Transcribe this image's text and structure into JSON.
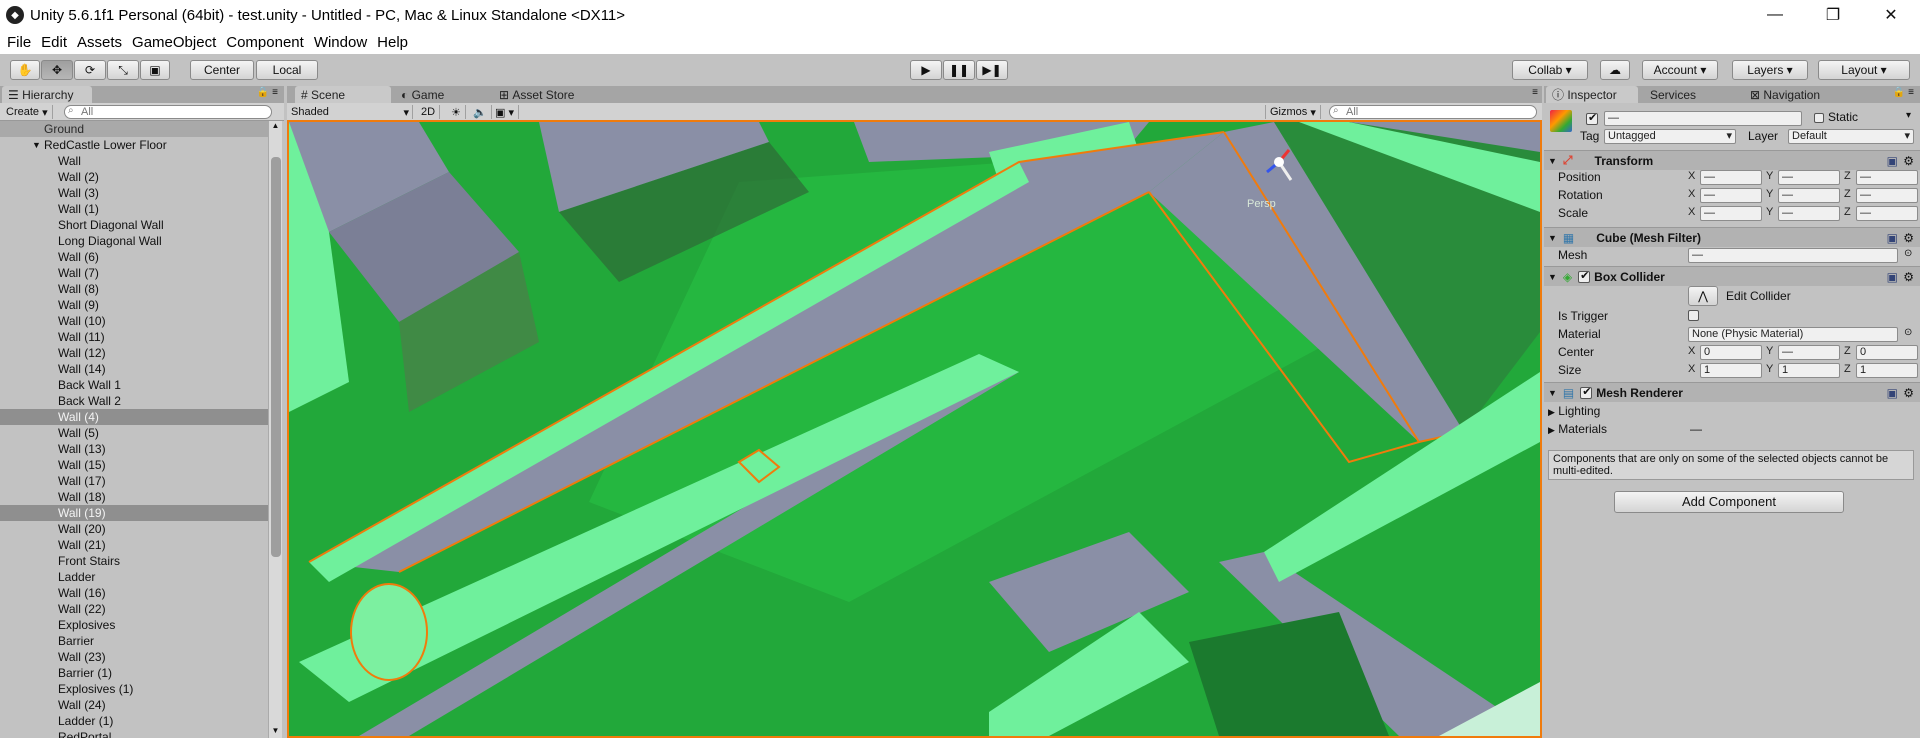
{
  "window": {
    "title": "Unity 5.6.1f1 Personal (64bit) - test.unity - Untitled - PC, Mac & Linux Standalone <DX11>",
    "minimize": "—",
    "maximize": "❐",
    "close": "✕"
  },
  "menu": [
    "File",
    "Edit",
    "Assets",
    "GameObject",
    "Component",
    "Window",
    "Help"
  ],
  "toolbar": {
    "pivot_center": "Center",
    "pivot_local": "Local",
    "collab": "Collab",
    "account": "Account",
    "layers": "Layers",
    "layout": "Layout"
  },
  "hierarchy": {
    "tab": "Hierarchy",
    "create": "Create",
    "search_placeholder": "All",
    "items": [
      {
        "label": "Ground",
        "indent": 0,
        "kind": "ground"
      },
      {
        "label": "RedCastle Lower Floor",
        "indent": 1,
        "kind": "parent"
      },
      {
        "label": "Wall",
        "indent": 2
      },
      {
        "label": "Wall (2)",
        "indent": 2
      },
      {
        "label": "Wall (3)",
        "indent": 2
      },
      {
        "label": "Wall (1)",
        "indent": 2
      },
      {
        "label": "Short Diagonal Wall",
        "indent": 2
      },
      {
        "label": "Long Diagonal Wall",
        "indent": 2
      },
      {
        "label": "Wall (6)",
        "indent": 2
      },
      {
        "label": "Wall (7)",
        "indent": 2
      },
      {
        "label": "Wall (8)",
        "indent": 2
      },
      {
        "label": "Wall (9)",
        "indent": 2
      },
      {
        "label": "Wall (10)",
        "indent": 2
      },
      {
        "label": "Wall (11)",
        "indent": 2
      },
      {
        "label": "Wall (12)",
        "indent": 2
      },
      {
        "label": "Wall (14)",
        "indent": 2
      },
      {
        "label": "Back Wall 1",
        "indent": 2
      },
      {
        "label": "Back Wall 2",
        "indent": 2
      },
      {
        "label": "Wall (4)",
        "indent": 2,
        "kind": "sel"
      },
      {
        "label": "Wall (5)",
        "indent": 2
      },
      {
        "label": "Wall (13)",
        "indent": 2
      },
      {
        "label": "Wall (15)",
        "indent": 2
      },
      {
        "label": "Wall (17)",
        "indent": 2
      },
      {
        "label": "Wall (18)",
        "indent": 2
      },
      {
        "label": "Wall (19)",
        "indent": 2,
        "kind": "sel"
      },
      {
        "label": "Wall (20)",
        "indent": 2
      },
      {
        "label": "Wall (21)",
        "indent": 2
      },
      {
        "label": "Front Stairs",
        "indent": 2
      },
      {
        "label": "Ladder",
        "indent": 2
      },
      {
        "label": "Wall (16)",
        "indent": 2
      },
      {
        "label": "Wall (22)",
        "indent": 2
      },
      {
        "label": "Explosives",
        "indent": 2
      },
      {
        "label": "Barrier",
        "indent": 2
      },
      {
        "label": "Wall (23)",
        "indent": 2
      },
      {
        "label": "Barrier (1)",
        "indent": 2
      },
      {
        "label": "Explosives (1)",
        "indent": 2
      },
      {
        "label": "Wall (24)",
        "indent": 2
      },
      {
        "label": "Ladder (1)",
        "indent": 2
      },
      {
        "label": "RedPortal",
        "indent": 2
      }
    ]
  },
  "scene": {
    "tabs": [
      "Scene",
      "Game",
      "Asset Store"
    ],
    "shading": "Shaded",
    "mode_2d": "2D",
    "gizmos": "Gizmos",
    "search_placeholder": "All",
    "persp_label": "Persp"
  },
  "inspector": {
    "tabs": [
      "Inspector",
      "Services",
      "Navigation"
    ],
    "name_value": "—",
    "static_label": "Static",
    "tag_label": "Tag",
    "tag_value": "Untagged",
    "layer_label": "Layer",
    "layer_value": "Default",
    "transform": {
      "title": "Transform",
      "position": "Position",
      "rotation": "Rotation",
      "scale": "Scale",
      "mixed": "—"
    },
    "mesh_filter": {
      "title": "Cube (Mesh Filter)",
      "mesh_label": "Mesh",
      "mesh_value": "—"
    },
    "box_collider": {
      "title": "Box Collider",
      "edit_collider": "Edit Collider",
      "is_trigger": "Is Trigger",
      "material": "Material",
      "material_value": "None (Physic Material)",
      "center": "Center",
      "center_x": "0",
      "center_y": "—",
      "center_z": "0",
      "size": "Size",
      "size_x": "1",
      "size_y": "1",
      "size_z": "1"
    },
    "mesh_renderer": {
      "title": "Mesh Renderer",
      "lighting": "Lighting",
      "materials": "Materials",
      "materials_value": "—"
    },
    "note": "Components that are only on some of the selected objects cannot be multi-edited.",
    "add_component": "Add Component",
    "axis_x": "X",
    "axis_y": "Y",
    "axis_z": "Z"
  }
}
